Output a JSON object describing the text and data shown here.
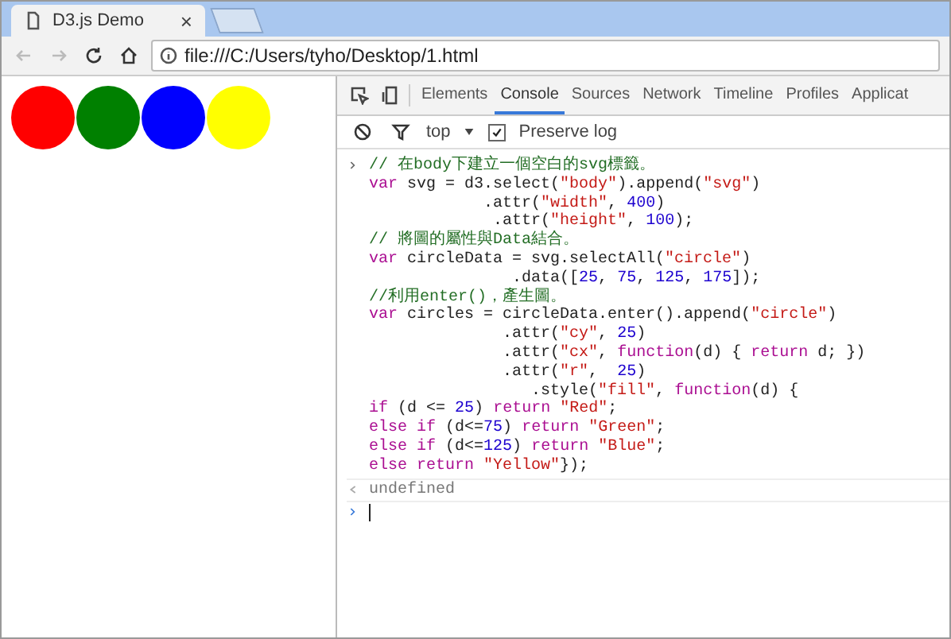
{
  "browser_tab": {
    "title": "D3.js Demo",
    "close": "×"
  },
  "address_bar": {
    "url": "file:///C:/Users/tyho/Desktop/1.html"
  },
  "page": {
    "circles": [
      {
        "color": "#ff0000"
      },
      {
        "color": "#008000"
      },
      {
        "color": "#0000ff"
      },
      {
        "color": "#ffff00"
      }
    ]
  },
  "devtools": {
    "tabs": [
      {
        "label": "Elements",
        "selected": false
      },
      {
        "label": "Console",
        "selected": true
      },
      {
        "label": "Sources",
        "selected": false
      },
      {
        "label": "Network",
        "selected": false
      },
      {
        "label": "Timeline",
        "selected": false
      },
      {
        "label": "Profiles",
        "selected": false
      },
      {
        "label": "Applicat",
        "selected": false
      }
    ],
    "toolbar": {
      "context": "top",
      "preserve_log": {
        "label": "Preserve log",
        "checked": true
      }
    },
    "console": {
      "input_lines": [
        [
          {
            "kind": "comment",
            "text": "// 在body下建立一個空白的svg標籤。"
          }
        ],
        [
          {
            "kind": "keyword",
            "text": "var"
          },
          {
            "kind": "plain",
            "text": " svg = d3.select("
          },
          {
            "kind": "string",
            "text": "\"body\""
          },
          {
            "kind": "plain",
            "text": ").append("
          },
          {
            "kind": "string",
            "text": "\"svg\""
          },
          {
            "kind": "plain",
            "text": ")"
          }
        ],
        [
          {
            "kind": "plain",
            "text": "            .attr("
          },
          {
            "kind": "string",
            "text": "\"width\""
          },
          {
            "kind": "plain",
            "text": ", "
          },
          {
            "kind": "number",
            "text": "400"
          },
          {
            "kind": "plain",
            "text": ")"
          }
        ],
        [
          {
            "kind": "plain",
            "text": "             .attr("
          },
          {
            "kind": "string",
            "text": "\"height\""
          },
          {
            "kind": "plain",
            "text": ", "
          },
          {
            "kind": "number",
            "text": "100"
          },
          {
            "kind": "plain",
            "text": ");"
          }
        ],
        [
          {
            "kind": "comment",
            "text": "// 將圖的屬性與Data結合。"
          }
        ],
        [
          {
            "kind": "keyword",
            "text": "var"
          },
          {
            "kind": "plain",
            "text": " circleData = svg.selectAll("
          },
          {
            "kind": "string",
            "text": "\"circle\""
          },
          {
            "kind": "plain",
            "text": ")"
          }
        ],
        [
          {
            "kind": "plain",
            "text": "               .data(["
          },
          {
            "kind": "number",
            "text": "25"
          },
          {
            "kind": "plain",
            "text": ", "
          },
          {
            "kind": "number",
            "text": "75"
          },
          {
            "kind": "plain",
            "text": ", "
          },
          {
            "kind": "number",
            "text": "125"
          },
          {
            "kind": "plain",
            "text": ", "
          },
          {
            "kind": "number",
            "text": "175"
          },
          {
            "kind": "plain",
            "text": "]);"
          }
        ],
        [
          {
            "kind": "comment",
            "text": "//利用enter()，產生圖。"
          }
        ],
        [
          {
            "kind": "keyword",
            "text": "var"
          },
          {
            "kind": "plain",
            "text": " circles = circleData.enter().append("
          },
          {
            "kind": "string",
            "text": "\"circle\""
          },
          {
            "kind": "plain",
            "text": ")"
          }
        ],
        [
          {
            "kind": "plain",
            "text": "              .attr("
          },
          {
            "kind": "string",
            "text": "\"cy\""
          },
          {
            "kind": "plain",
            "text": ", "
          },
          {
            "kind": "number",
            "text": "25"
          },
          {
            "kind": "plain",
            "text": ")"
          }
        ],
        [
          {
            "kind": "plain",
            "text": "              .attr("
          },
          {
            "kind": "string",
            "text": "\"cx\""
          },
          {
            "kind": "plain",
            "text": ", "
          },
          {
            "kind": "keyword",
            "text": "function"
          },
          {
            "kind": "plain",
            "text": "(d) { "
          },
          {
            "kind": "keyword",
            "text": "return"
          },
          {
            "kind": "plain",
            "text": " d; })"
          }
        ],
        [
          {
            "kind": "plain",
            "text": "              .attr("
          },
          {
            "kind": "string",
            "text": "\"r\""
          },
          {
            "kind": "plain",
            "text": ",  "
          },
          {
            "kind": "number",
            "text": "25"
          },
          {
            "kind": "plain",
            "text": ")"
          }
        ],
        [
          {
            "kind": "plain",
            "text": "                 .style("
          },
          {
            "kind": "string",
            "text": "\"fill\""
          },
          {
            "kind": "plain",
            "text": ", "
          },
          {
            "kind": "keyword",
            "text": "function"
          },
          {
            "kind": "plain",
            "text": "(d) {"
          }
        ],
        [
          {
            "kind": "keyword",
            "text": "if"
          },
          {
            "kind": "plain",
            "text": " (d <= "
          },
          {
            "kind": "number",
            "text": "25"
          },
          {
            "kind": "plain",
            "text": ") "
          },
          {
            "kind": "keyword",
            "text": "return"
          },
          {
            "kind": "string",
            "text": " \"Red\""
          },
          {
            "kind": "plain",
            "text": ";"
          }
        ],
        [
          {
            "kind": "keyword",
            "text": "else if"
          },
          {
            "kind": "plain",
            "text": " (d<="
          },
          {
            "kind": "number",
            "text": "75"
          },
          {
            "kind": "plain",
            "text": ") "
          },
          {
            "kind": "keyword",
            "text": "return"
          },
          {
            "kind": "string",
            "text": " \"Green\""
          },
          {
            "kind": "plain",
            "text": ";"
          }
        ],
        [
          {
            "kind": "keyword",
            "text": "else if"
          },
          {
            "kind": "plain",
            "text": " (d<="
          },
          {
            "kind": "number",
            "text": "125"
          },
          {
            "kind": "plain",
            "text": ") "
          },
          {
            "kind": "keyword",
            "text": "return"
          },
          {
            "kind": "string",
            "text": " \"Blue\""
          },
          {
            "kind": "plain",
            "text": ";"
          }
        ],
        [
          {
            "kind": "keyword",
            "text": "else return"
          },
          {
            "kind": "string",
            "text": " \"Yellow\""
          },
          {
            "kind": "plain",
            "text": "});"
          }
        ]
      ],
      "result": "undefined"
    }
  }
}
